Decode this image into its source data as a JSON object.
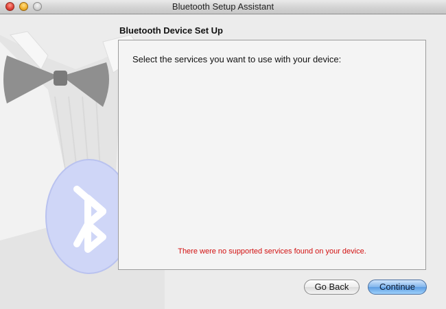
{
  "window": {
    "title": "Bluetooth Setup Assistant"
  },
  "content": {
    "heading": "Bluetooth Device Set Up",
    "prompt": "Select the services you want to use with your device:",
    "error_message": "There were no supported services found on your device."
  },
  "buttons": {
    "back_label": "Go Back",
    "continue_label": "Continue"
  },
  "colors": {
    "error_text": "#d21010",
    "default_button": "#6aa8e8",
    "bluetooth_badge": "#cfd6f7"
  },
  "icons": {
    "artwork": "tuxedo-bowtie-bluetooth-illustration",
    "badge": "bluetooth-icon"
  }
}
